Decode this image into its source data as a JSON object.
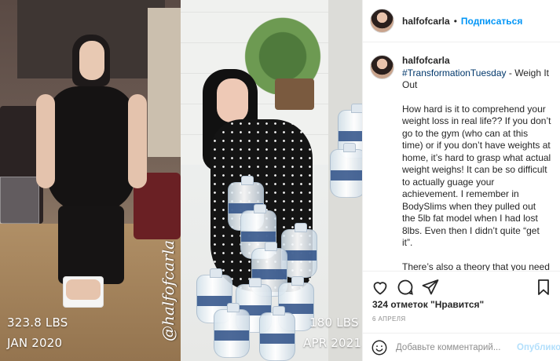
{
  "post": {
    "author": "halfofcarla",
    "follow_label": "Подписаться",
    "separator": "•",
    "caption": {
      "hashtag": "#TransformationTuesday",
      "title_suffix": "- Weigh It Out",
      "paragraph1": "How hard is it to comprehend your weight loss in real life?? If you don’t go to the gym (who can at this time) or if you don’t have weights at home, it’s hard to grasp what actual weight weighs! It can be so difficult to actually guage your achievement. I remember in BodySlims when they pulled out the 5lb fat model when I had lost 8lbs. Even then I didn’t quite “get it”.",
      "paragraph2": "There’s also a theory that you need your brain to catch up with your achievement so that you don’t self sabotage. One of the trickiest things I’ve found about transitioning to"
    },
    "likes_label": "324 отметок \"Нравится\"",
    "date_label": "6 АПРЕЛЯ",
    "comment_placeholder": "Добавьте комментарий...",
    "post_button_label": "Опубликовать"
  },
  "image": {
    "before": {
      "weight": "323.8 LBS",
      "date": "JAN 2020"
    },
    "after": {
      "weight": "180 LBS",
      "date": "APR 2021"
    },
    "watermark": "@halfofcarla"
  },
  "icons": {
    "like": "heart-icon",
    "comment": "comment-bubble-icon",
    "share": "paper-plane-icon",
    "save": "bookmark-icon",
    "emoji": "smiley-icon"
  },
  "colors": {
    "accent": "#0095f6",
    "hashtag": "#00376b",
    "text": "#262626",
    "muted": "#8e8e8e",
    "post_button_disabled": "#b2dffc"
  }
}
